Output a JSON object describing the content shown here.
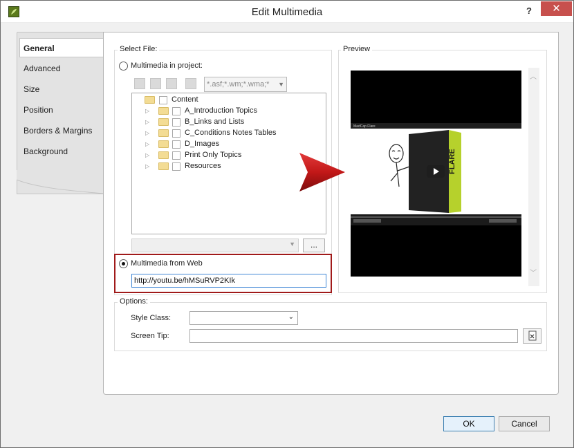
{
  "window": {
    "title": "Edit Multimedia",
    "help": "?",
    "close": "✕"
  },
  "tabs": [
    "General",
    "Advanced",
    "Size",
    "Position",
    "Borders & Margins",
    "Background"
  ],
  "select_file": {
    "label": "Select File:",
    "option_project": "Multimedia in project:",
    "filter": "*.asf;*.wm;*.wma;*",
    "tree": {
      "root": "Content",
      "items": [
        "A_Introduction Topics",
        "B_Links and Lists",
        "C_Conditions Notes Tables",
        "D_Images",
        "Print Only Topics",
        "Resources"
      ]
    },
    "browse": "...",
    "option_web": "Multimedia from Web",
    "url": "http://youtu.be/hMSuRVP2KIk"
  },
  "preview": {
    "label": "Preview",
    "video_caption": "MadCap Flare",
    "product": "FLARE"
  },
  "options": {
    "label": "Options:",
    "style_class_label": "Style Class:",
    "style_class_value": "",
    "screen_tip_label": "Screen Tip:",
    "screen_tip_value": ""
  },
  "buttons": {
    "ok": "OK",
    "cancel": "Cancel"
  },
  "colors": {
    "highlight_box": "#a01a1a",
    "close_button": "#c7504d",
    "focus_border": "#3f86d6"
  }
}
